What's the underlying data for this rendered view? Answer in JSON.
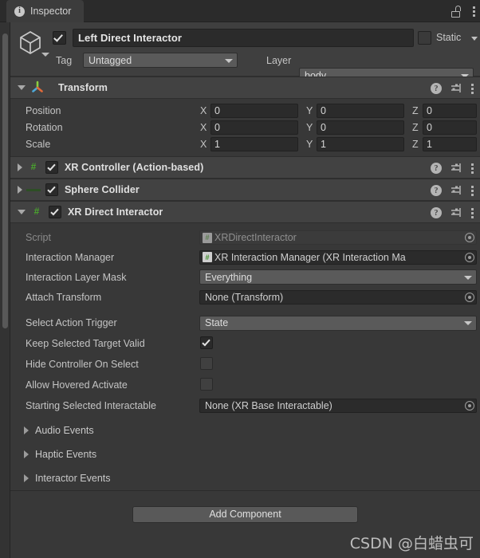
{
  "window": {
    "tab_label": "Inspector",
    "tab_icon": "info-icon",
    "lock_icon": "padlock-open-icon",
    "menu_icon": "kebab-menu-icon"
  },
  "gameobject": {
    "icon": "cube-prefab-icon",
    "enabled": true,
    "name": "Left Direct Interactor",
    "static_label": "Static",
    "static_checked": false,
    "tag_label": "Tag",
    "tag_value": "Untagged",
    "layer_label": "Layer",
    "layer_value": "body"
  },
  "transform": {
    "title": "Transform",
    "icon": "transform-axes-icon",
    "expanded": true,
    "rows": [
      {
        "label": "Position",
        "x": "0",
        "y": "0",
        "z": "0"
      },
      {
        "label": "Rotation",
        "x": "0",
        "y": "0",
        "z": "0"
      },
      {
        "label": "Scale",
        "x": "1",
        "y": "1",
        "z": "1"
      }
    ],
    "axis_x": "X",
    "axis_y": "Y",
    "axis_z": "Z"
  },
  "components": [
    {
      "title": "XR Controller (Action-based)",
      "icon": "csharp-script-icon",
      "enabled": true,
      "expanded": false
    },
    {
      "title": "Sphere Collider",
      "icon": "sphere-collider-icon",
      "enabled": true,
      "expanded": false
    },
    {
      "title": "XR Direct Interactor",
      "icon": "csharp-script-icon",
      "enabled": true,
      "expanded": true
    }
  ],
  "xr_direct_interactor": {
    "script": {
      "label": "Script",
      "value": "XRDirectInteractor"
    },
    "interaction_manager": {
      "label": "Interaction Manager",
      "value": "XR Interaction Manager (XR Interaction Ma"
    },
    "interaction_layer_mask": {
      "label": "Interaction Layer Mask",
      "value": "Everything"
    },
    "attach_transform": {
      "label": "Attach Transform",
      "value": "None (Transform)"
    },
    "select_action_trigger": {
      "label": "Select Action Trigger",
      "value": "State"
    },
    "keep_selected_target_valid": {
      "label": "Keep Selected Target Valid",
      "checked": true
    },
    "hide_controller_on_select": {
      "label": "Hide Controller On Select",
      "checked": false
    },
    "allow_hovered_activate": {
      "label": "Allow Hovered Activate",
      "checked": false
    },
    "starting_selected_interactable": {
      "label": "Starting Selected Interactable",
      "value": "None (XR Base Interactable)"
    },
    "foldouts": [
      {
        "label": "Audio Events"
      },
      {
        "label": "Haptic Events"
      },
      {
        "label": "Interactor Events"
      }
    ]
  },
  "footer": {
    "add_component_label": "Add Component",
    "watermark": "CSDN @白蜡虫可"
  },
  "colors": {
    "window_bg": "#383838",
    "header_bg": "#424242",
    "field_bg": "#2b2b2b",
    "dropdown_bg": "#5a5a5a",
    "accent_green": "#7ddb3a",
    "text": "#c4c4c4"
  }
}
